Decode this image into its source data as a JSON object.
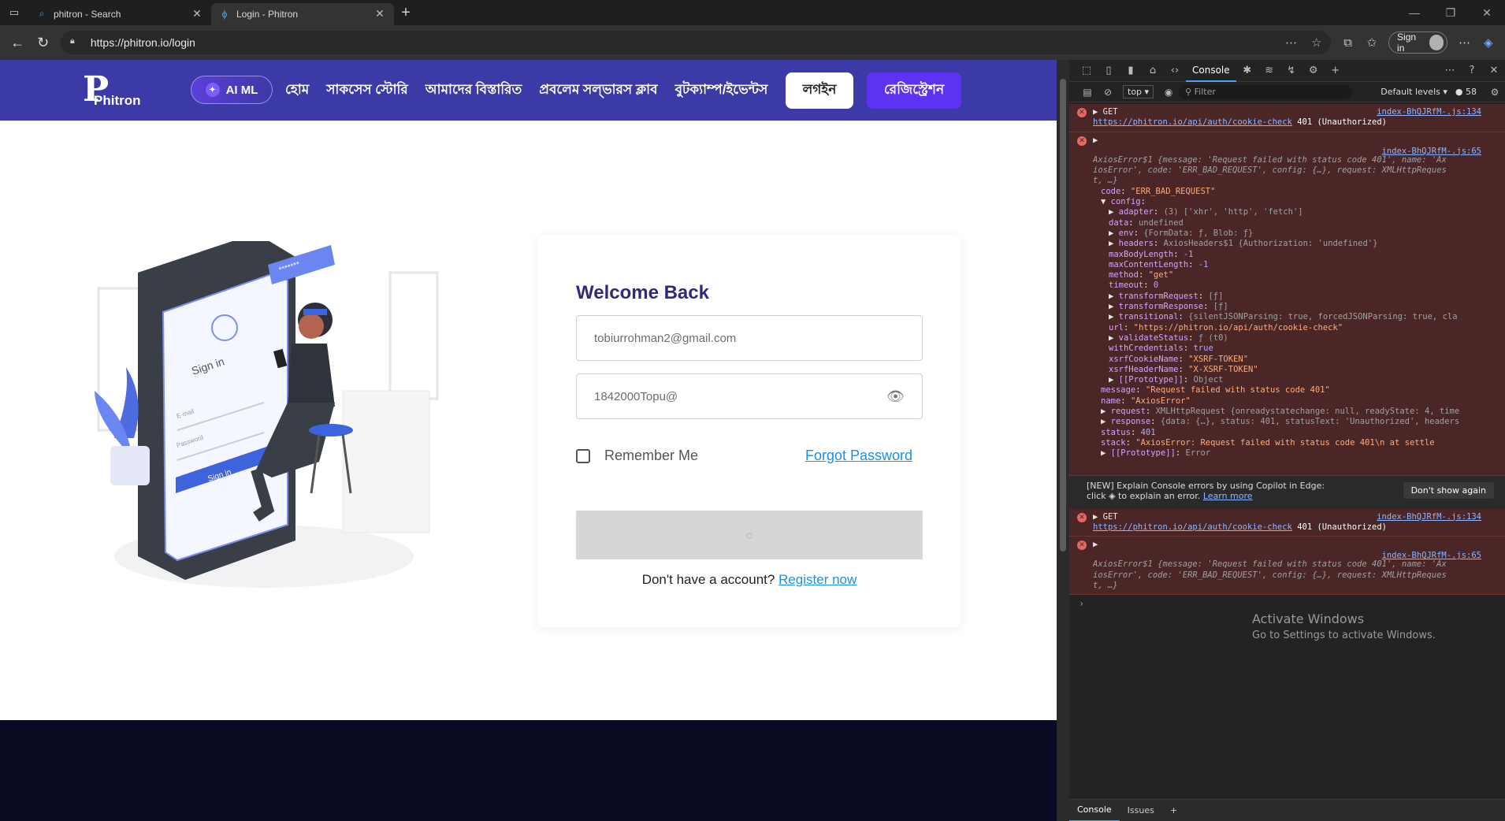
{
  "tabs": [
    {
      "title": "phitron - Search",
      "active": false
    },
    {
      "title": "Login - Phitron",
      "active": true
    }
  ],
  "address": {
    "url": "https://phitron.io/login",
    "signin": "Sign in"
  },
  "nav": {
    "logo_mark": "P",
    "logo_word": "Phitron",
    "aiml": "AI ML",
    "links": [
      "হোম",
      "সাকসেস স্টোরি",
      "আমাদের বিস্তারিত",
      "প্রবলেম সল্ভারস ক্লাব",
      "বুটক্যাম্প/ইভেন্টস"
    ],
    "login": "লগইন",
    "register": "রেজিস্ট্রেশন"
  },
  "illustration": {
    "screen_title": "Sign in",
    "email_label": "E-mail",
    "password_label": "Password",
    "button": "Sign in",
    "bubble": "*******"
  },
  "login": {
    "title": "Welcome Back",
    "email": "tobiurrohman2@gmail.com",
    "password": "1842000Topu@",
    "remember": "Remember Me",
    "forgot": "Forgot Password",
    "no_account": "Don't have a account?",
    "register_link": "Register now"
  },
  "devtools": {
    "console_tab": "Console",
    "context": "top",
    "filter_placeholder": "Filter",
    "levels": "Default levels",
    "issue_count": "58",
    "log1": {
      "method": "GET",
      "source": "index-BhQJRfM-.js:134",
      "url": "https://phitron.io/api/auth/cookie-check",
      "status": "401 (Unauthorized)"
    },
    "log2": {
      "source": "index-BhQJRfM-.js:65",
      "summary1": "AxiosError$1 {message: 'Request failed with status code 401', name: 'Ax",
      "summary2": "iosError', code: 'ERR_BAD_REQUEST', config: {…}, request: XMLHttpReques",
      "summary3": "t, …}",
      "lines": [
        {
          "key": "code",
          "val": "\"ERR_BAD_REQUEST\""
        },
        {
          "key": "config",
          "val": ""
        },
        {
          "key": "adapter",
          "val": "(3) ['xhr', 'http', 'fetch']"
        },
        {
          "key": "data",
          "val": "undefined"
        },
        {
          "key": "env",
          "val": "{FormData: ƒ, Blob: ƒ}"
        },
        {
          "key": "headers",
          "val": "AxiosHeaders$1 {Authorization: 'undefined'}"
        },
        {
          "key": "maxBodyLength",
          "val": "-1"
        },
        {
          "key": "maxContentLength",
          "val": "-1"
        },
        {
          "key": "method",
          "val": "\"get\""
        },
        {
          "key": "timeout",
          "val": "0"
        },
        {
          "key": "transformRequest",
          "val": "[ƒ]"
        },
        {
          "key": "transformResponse",
          "val": "[ƒ]"
        },
        {
          "key": "transitional",
          "val": "{silentJSONParsing: true, forcedJSONParsing: true, cla"
        },
        {
          "key": "url",
          "val": "\"https://phitron.io/api/auth/cookie-check\""
        },
        {
          "key": "validateStatus",
          "val": "ƒ (t0)"
        },
        {
          "key": "withCredentials",
          "val": "true"
        },
        {
          "key": "xsrfCookieName",
          "val": "\"XSRF-TOKEN\""
        },
        {
          "key": "xsrfHeaderName",
          "val": "\"X-XSRF-TOKEN\""
        },
        {
          "key": "[[Prototype]]",
          "val": "Object"
        },
        {
          "key": "message",
          "val": "\"Request failed with status code 401\""
        },
        {
          "key": "name",
          "val": "\"AxiosError\""
        },
        {
          "key": "request",
          "val": "XMLHttpRequest {onreadystatechange: null, readyState: 4, time"
        },
        {
          "key": "response",
          "val": "{data: {…}, status: 401, statusText: 'Unauthorized', headers"
        },
        {
          "key": "status",
          "val": "401"
        },
        {
          "key": "stack",
          "val": "\"AxiosError: Request failed with status code 401\\n    at settle"
        },
        {
          "key": "[[Prototype]]",
          "val": "Error"
        }
      ]
    },
    "copilot": {
      "text1": "[NEW] Explain Console errors by using Copilot in Edge:",
      "text2a": "click",
      "text2b": "to explain an error.",
      "learn": "Learn more",
      "dismiss": "Don't show again"
    },
    "log3": {
      "method": "GET",
      "source": "index-BhQJRfM-.js:134",
      "url": "https://phitron.io/api/auth/cookie-check",
      "status": "401 (Unauthorized)"
    },
    "log4": {
      "source": "index-BhQJRfM-.js:65"
    },
    "bottom_tabs": [
      "Console",
      "Issues"
    ]
  },
  "watermark": {
    "line1": "Activate Windows",
    "line2": "Go to Settings to activate Windows."
  }
}
